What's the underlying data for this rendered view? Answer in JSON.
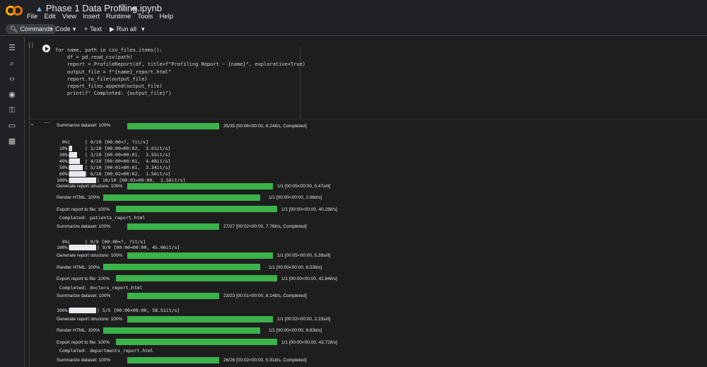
{
  "header": {
    "title": "Phase 1 Data Profiling.ipynb",
    "menu": [
      "File",
      "Edit",
      "View",
      "Insert",
      "Runtime",
      "Tools",
      "Help"
    ]
  },
  "toolbar": {
    "commands": "Commands",
    "code": "Code",
    "text": "Text",
    "run_all": "Run all"
  },
  "cell": {
    "bracket": "[ ]",
    "code_lines": [
      "for name, path in csv_files.items():",
      "    df = pd.read_csv(path)",
      "    report = ProfileReport(df, title=f\"Profiling Report - {name}\", explorative=True)",
      "    output_file = f\"{name}_report.html\"",
      "    report.to_file(output_file)",
      "    report_files.append(output_file)",
      "    print(f\" Completed: {output_file}\")"
    ]
  },
  "output": {
    "summarize_1": {
      "label": "Summarize dataset: 100%",
      "stat": "35/35 [00:06<00:00,   6.24it/s, Completed]",
      "fill": 1.0
    },
    "partial_1": [
      "   0%|          | 0/10 [00:00<?, ?it/s]",
      " 10%|█         | 1/10 [00:00<00:02,  3.61it/s]",
      " 30%|███       | 3/10 [00:00<00:01,  3.55it/s]",
      " 40%|████      | 4/10 [00:00<00:01,  4.48it/s]",
      " 50%|█████     | 5/10 [00:01<00:01,  3.34it/s]",
      " 60%|██████    | 6/10 [00:02<00:02,  1.56it/s]",
      "100%|██████████| 10/10 [00:03<00:00,  2.56it/s]"
    ],
    "partial_1_labels": [
      "  0%|",
      " 10%|",
      " 30%|",
      " 40%|",
      " 50%|",
      " 60%|",
      "100%|"
    ],
    "partial_1_stats": [
      "| 0/10 [00:00<?, ?it/s]",
      "| 1/10 [00:00<00:02,  3.61it/s]",
      "| 3/10 [00:00<00:01,  3.55it/s]",
      "| 4/10 [00:00<00:01,  4.48it/s]",
      "| 5/10 [00:01<00:01,  3.34it/s]",
      "| 6/10 [00:02<00:02,  1.56it/s]",
      "| 10/10 [00:03<00:00,  2.56it/s]"
    ],
    "partial_1_fill": [
      0.0,
      0.1,
      0.3,
      0.4,
      0.5,
      0.6,
      1.0
    ],
    "gen_1": {
      "label": "Generate report structure: 100%",
      "stat": "1/1 [00:05<00:00,   5.47s/it]"
    },
    "render_1": {
      "label": "Render HTML: 100%",
      "stat": "1/1 [00:00<00:00,   2.86it/s]"
    },
    "export_1": {
      "label": "Export report to file: 100%",
      "stat": "1/1 [00:00<00:00,  40.28it/s]"
    },
    "completed_1": " Completed: patients_report.html",
    "summarize_2": {
      "label": "Summarize dataset: 100%",
      "stat": "27/27 [00:02<00:00,   7.76it/s, Completed]"
    },
    "partial_2_labels": [
      "  0%|",
      "100%|"
    ],
    "partial_2_stats": [
      "| 0/9 [00:00<?, ?it/s]",
      "| 9/9 [00:00<00:00, 45.06it/s]"
    ],
    "partial_2_fill": [
      0.0,
      1.0
    ],
    "gen_2": {
      "label": "Generate report structure: 100%",
      "stat": "1/1 [00:05<00:00,   5.39s/it]"
    },
    "render_2": {
      "label": "Render HTML: 100%",
      "stat": "1/1 [00:00<00:00,   6.53it/s]"
    },
    "export_2": {
      "label": "Export report to file: 100%",
      "stat": "1/1 [00:00<00:00,  42.84it/s]"
    },
    "completed_2": " Completed: doctors_report.html",
    "summarize_3": {
      "label": "Summarize dataset: 100%",
      "stat": "23/23 [00:01<00:00,   8.14it/s, Completed]"
    },
    "partial_3_label": "100%|",
    "partial_3_stat": "| 5/5 [00:00<00:00, 58.51it/s]",
    "gen_3": {
      "label": "Generate report structure: 100%",
      "stat": "1/1 [00:02<00:00,   2.23s/it]"
    },
    "render_3": {
      "label": "Render HTML: 100%",
      "stat": "1/1 [00:00<00:00,   9.83it/s]"
    },
    "export_3": {
      "label": "Export report to file: 100%",
      "stat": "1/1 [00:00<00:00,  43.72it/s]"
    },
    "completed_3": " Completed: departments_report.html",
    "summarize_4": {
      "label": "Summarize dataset: 100%",
      "stat": "26/26 [00:02<00:00,   5.91it/s, Completed]"
    }
  }
}
